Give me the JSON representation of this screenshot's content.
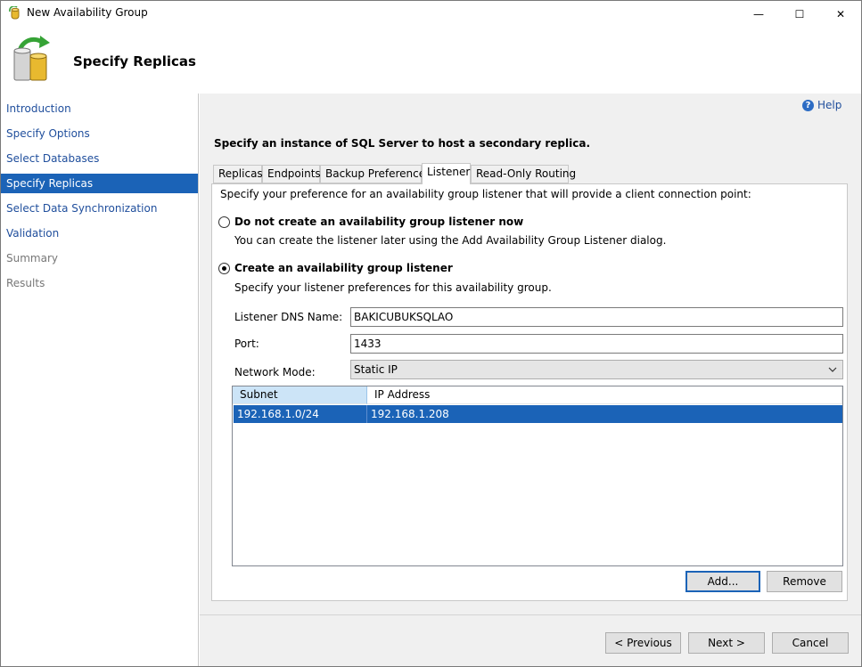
{
  "window": {
    "title": "New Availability Group",
    "controls": {
      "minimize": "—",
      "maximize": "☐",
      "close": "✕"
    }
  },
  "header": {
    "title": "Specify Replicas",
    "icon": "database-refresh-icon"
  },
  "nav": {
    "items": [
      {
        "label": "Introduction",
        "state": "normal"
      },
      {
        "label": "Specify Options",
        "state": "normal"
      },
      {
        "label": "Select Databases",
        "state": "normal"
      },
      {
        "label": "Specify Replicas",
        "state": "selected"
      },
      {
        "label": "Select Data Synchronization",
        "state": "normal"
      },
      {
        "label": "Validation",
        "state": "normal"
      },
      {
        "label": "Summary",
        "state": "disabled"
      },
      {
        "label": "Results",
        "state": "disabled"
      }
    ]
  },
  "help": {
    "label": "Help",
    "icon": "help-icon"
  },
  "instruction": "Specify an instance of SQL Server to host a secondary replica.",
  "tabs": [
    "Replicas",
    "Endpoints",
    "Backup Preferences",
    "Listener",
    "Read-Only Routing"
  ],
  "active_tab": "Listener",
  "listener": {
    "description": "Specify your preference for an availability group listener that will provide a client connection point:",
    "option_none": {
      "label": "Do not create an availability group listener now",
      "hint": "You can create the listener later using the Add Availability Group Listener dialog.",
      "selected": false
    },
    "option_create": {
      "label": "Create an availability group listener",
      "hint": "Specify your listener preferences for this availability group.",
      "selected": true
    },
    "dns_label": "Listener DNS Name:",
    "dns_value": "BAKICUBUKSQLAO",
    "port_label": "Port:",
    "port_value": "1433",
    "mode_label": "Network Mode:",
    "mode_value": "Static IP",
    "grid": {
      "columns": [
        "Subnet",
        "IP Address"
      ],
      "rows": [
        {
          "subnet": "192.168.1.0/24",
          "ip": "192.168.1.208"
        }
      ]
    },
    "add_label": "Add...",
    "remove_label": "Remove"
  },
  "footer": {
    "previous": "< Previous",
    "next": "Next >",
    "cancel": "Cancel"
  },
  "colors": {
    "selection": "#1b63b7",
    "link": "#1f4e9c",
    "panel_bg": "#f0f0f0"
  }
}
